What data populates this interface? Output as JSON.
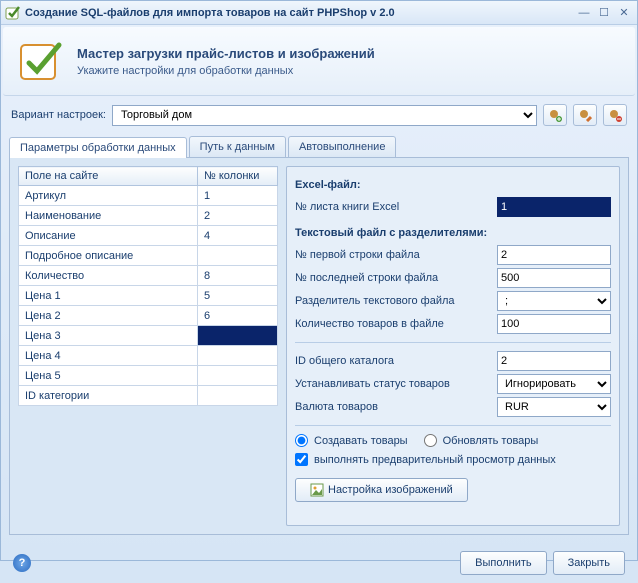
{
  "window": {
    "title": "Создание SQL-файлов для импорта товаров на сайт PHPShop v 2.0"
  },
  "header": {
    "title": "Мастер загрузки прайс-листов и изображений",
    "subtitle": "Укажите настройки для обработки данных"
  },
  "variant": {
    "label": "Вариант настроек:",
    "value": "Торговый дом"
  },
  "tabs": [
    {
      "label": "Параметры обработки данных",
      "active": true
    },
    {
      "label": "Путь к данным",
      "active": false
    },
    {
      "label": "Автовыполнение",
      "active": false
    }
  ],
  "grid": {
    "headers": {
      "field": "Поле на сайте",
      "col": "№ колонки"
    },
    "rows": [
      {
        "field": "Артикул",
        "col": "1"
      },
      {
        "field": "Наименование",
        "col": "2"
      },
      {
        "field": "Описание",
        "col": "4"
      },
      {
        "field": "Подробное описание",
        "col": ""
      },
      {
        "field": "Количество",
        "col": "8"
      },
      {
        "field": "Цена 1",
        "col": "5"
      },
      {
        "field": "Цена 2",
        "col": "6"
      },
      {
        "field": "Цена 3",
        "col": "",
        "selected": true
      },
      {
        "field": "Цена 4",
        "col": ""
      },
      {
        "field": "Цена 5",
        "col": ""
      },
      {
        "field": "ID категории",
        "col": ""
      }
    ]
  },
  "excel": {
    "title": "Excel-файл:",
    "sheet_label": "№ листа книги Excel",
    "sheet_value": "1"
  },
  "textfile": {
    "title": "Текстовый файл с разделителями:",
    "first_row_label": "№ первой строки файла",
    "first_row_value": "2",
    "last_row_label": "№ последней строки файла",
    "last_row_value": "500",
    "delim_label": "Разделитель текстового файла",
    "delim_value": ";",
    "count_label": "Количество товаров в файле",
    "count_value": "100"
  },
  "catalog": {
    "id_label": "ID общего каталога",
    "id_value": "2",
    "status_label": "Устанавливать статус товаров",
    "status_value": "Игнорировать",
    "currency_label": "Валюта товаров",
    "currency_value": "RUR"
  },
  "options": {
    "create": "Создавать товары",
    "update": "Обновлять товары",
    "preview": "выполнять предварительный просмотр данных",
    "image_btn": "Настройка изображений"
  },
  "footer": {
    "run": "Выполнить",
    "close": "Закрыть"
  }
}
